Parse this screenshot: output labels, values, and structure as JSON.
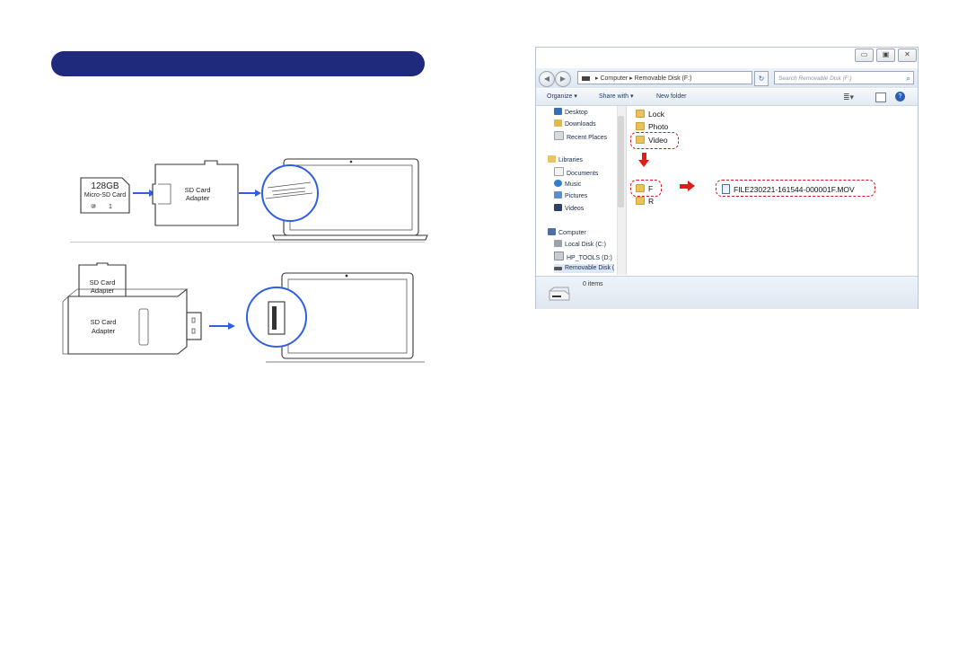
{
  "left_page": {
    "title": "",
    "step1": {
      "card_capacity": "128GB",
      "card_type": "Micro-SD Card",
      "card_mark1": "⑩",
      "card_mark2": "1",
      "adapter_line1": "SD Card",
      "adapter_line2": "Adapter"
    },
    "step2": {
      "card_line1": "SD Card",
      "card_line2": "Adapter",
      "reader_line1": "SD Card",
      "reader_line2": "Adapter"
    }
  },
  "explorer": {
    "window_buttons": [
      "▭",
      "▣",
      "✕"
    ],
    "breadcrumb": [
      "Computer",
      "Removable Disk (F:)"
    ],
    "search_placeholder": "Search Removable Disk (F:)",
    "toolbar": {
      "organize": "Organize ▾",
      "share_with": "Share with ▾",
      "new_folder": "New folder"
    },
    "nav": {
      "favorites": [
        "Desktop",
        "Downloads",
        "Recent Places"
      ],
      "libraries_title": "Libraries",
      "libraries": [
        "Documents",
        "Music",
        "Pictures",
        "Videos"
      ],
      "computer_title": "Computer",
      "drives": [
        "Local Disk (C:)",
        "HP_TOOLS (D:)",
        "Removable Disk ("
      ]
    },
    "folders": [
      "Lock",
      "Photo",
      "Video"
    ],
    "subfolders": [
      "F",
      "R"
    ],
    "file": "FILE230221-161544-000001F.MOV",
    "status": "0 items",
    "highlight_color": "#d8151a"
  }
}
